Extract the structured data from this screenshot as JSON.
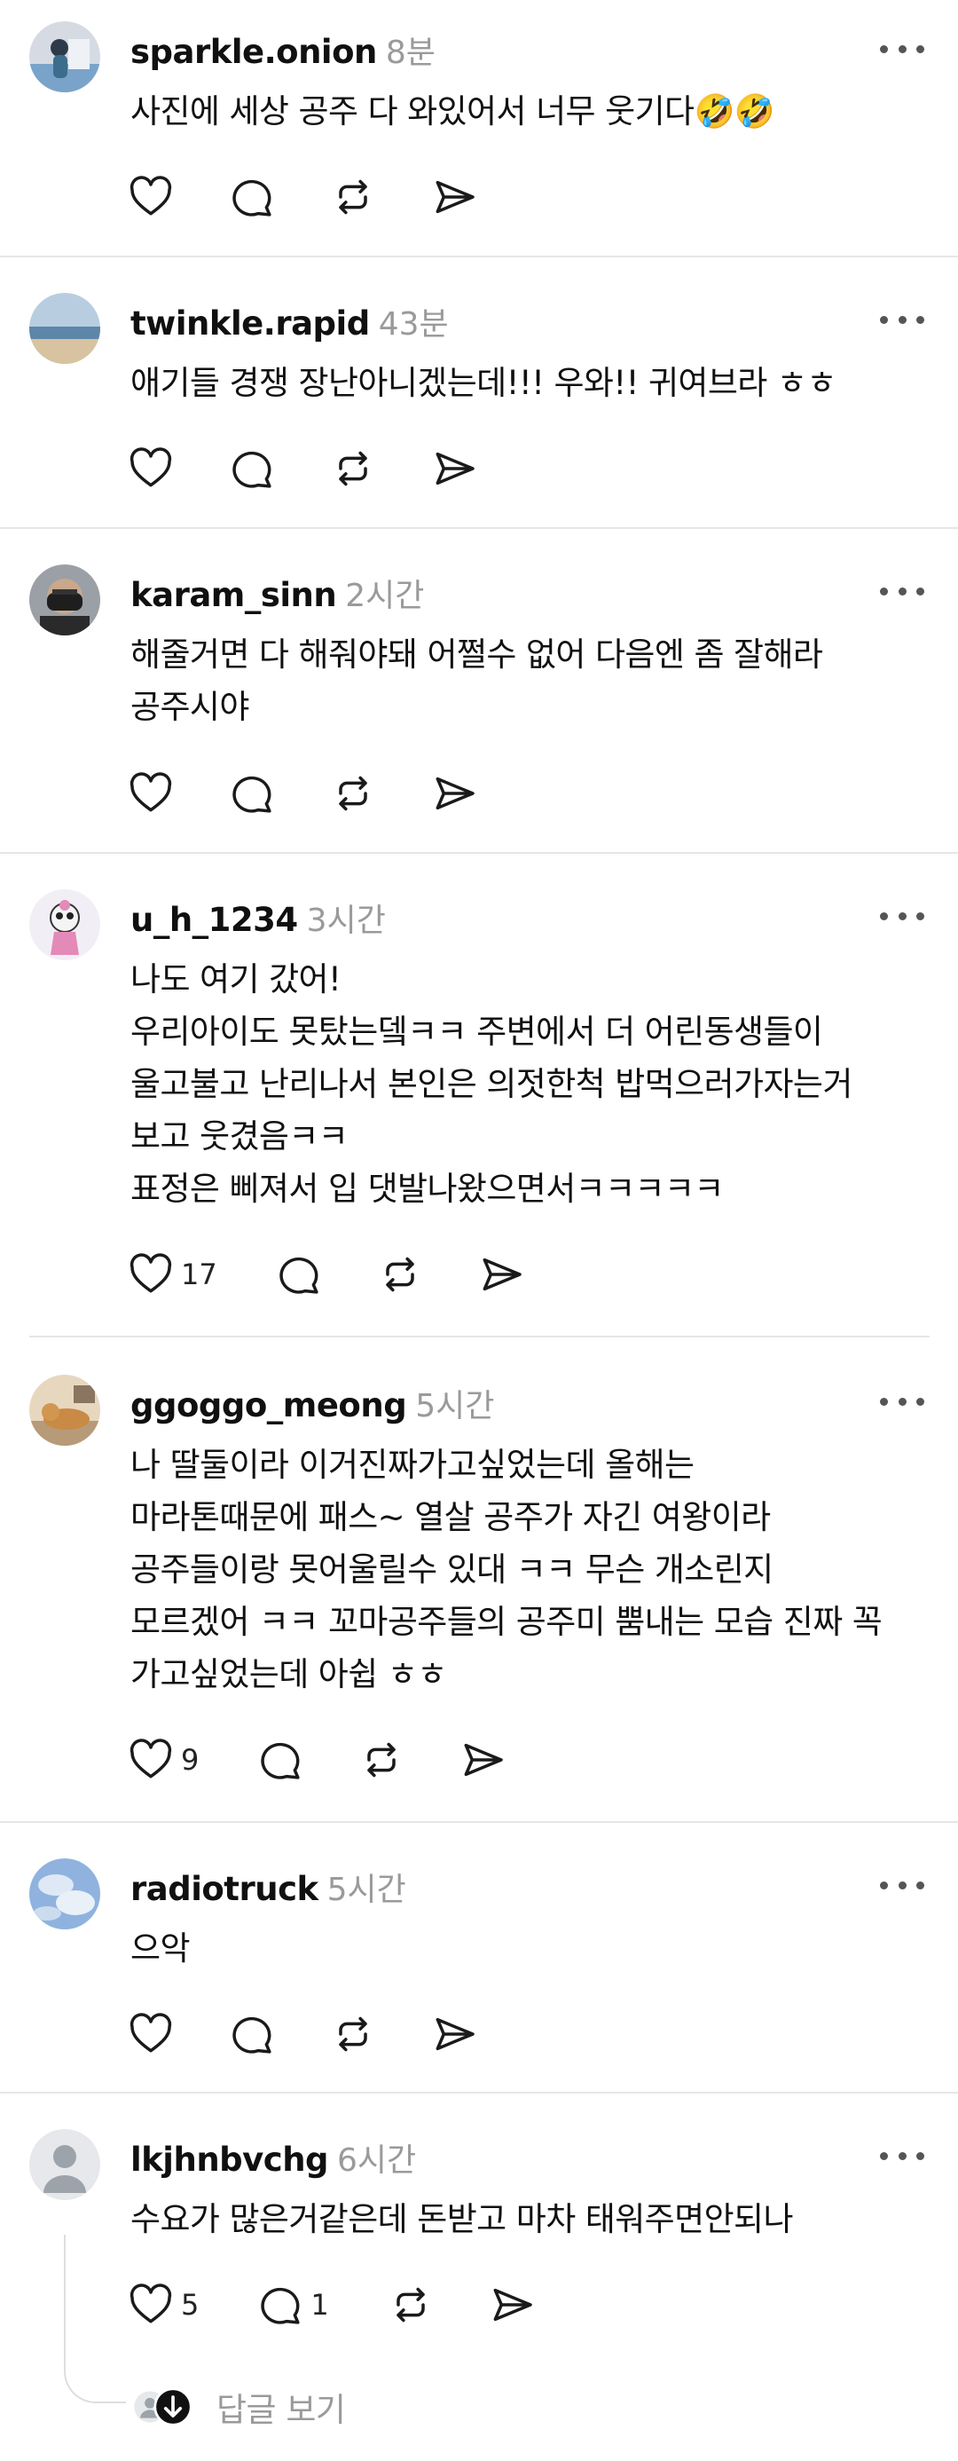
{
  "posts": [
    {
      "username": "sparkle.onion",
      "time": "8분",
      "lines": [
        "사진에 세상 공주 다 와있어서 너무 웃기다🤣🤣"
      ],
      "likes": "",
      "replies": ""
    },
    {
      "username": "twinkle.rapid",
      "time": "43분",
      "lines": [
        "애기들 경쟁 장난아니겠는데!!! 우와!! 귀여브라 ㅎㅎ"
      ],
      "likes": "",
      "replies": ""
    },
    {
      "username": "karam_sinn",
      "time": "2시간",
      "lines": [
        "해줄거면 다 해줘야돼 어쩔수 없어 다음엔 좀 잘해라",
        "공주시야"
      ],
      "likes": "",
      "replies": ""
    },
    {
      "username": "u_h_1234",
      "time": "3시간",
      "lines": [
        "나도 여기 갔어!",
        "우리아이도 못탔는뎈ㅋㅋ 주변에서 더 어린동생들이",
        "울고불고 난리나서 본인은 의젓한척 밥먹으러가자는거",
        "보고 웃겼음ㅋㅋ",
        "표정은 삐져서 입 댓발나왔으면서ㅋㅋㅋㅋㅋ"
      ],
      "likes": "17",
      "replies": ""
    },
    {
      "username": "ggoggo_meong",
      "time": "5시간",
      "lines": [
        "나 딸둘이라 이거진짜가고싶었는데 올해는",
        "마라톤때문에 패스~ 열살 공주가 자긴 여왕이라",
        "공주들이랑 못어울릴수 있대 ㅋㅋ 무슨 개소린지",
        "모르겠어 ㅋㅋ 꼬마공주들의 공주미 뿜내는 모습 진짜 꼭",
        "가고싶었는데 아쉽 ㅎㅎ"
      ],
      "likes": "9",
      "replies": ""
    },
    {
      "username": "radiotruck",
      "time": "5시간",
      "lines": [
        "으악"
      ],
      "likes": "",
      "replies": ""
    },
    {
      "username": "lkjhnbvchg",
      "time": "6시간",
      "lines": [
        "수요가 많은거같은데 돈받고 마차 태워주면안되나"
      ],
      "likes": "5",
      "replies": "1"
    }
  ],
  "view_replies_label": "답글 보기"
}
